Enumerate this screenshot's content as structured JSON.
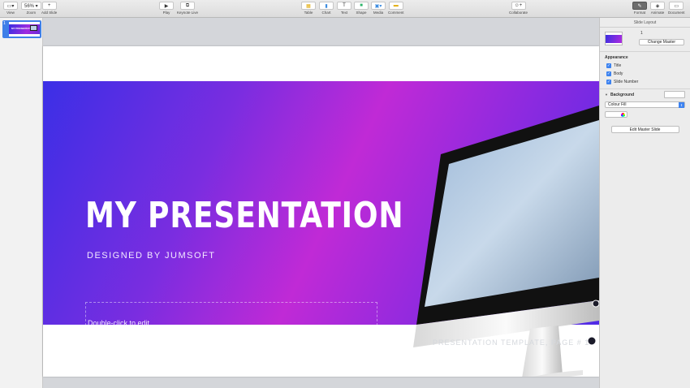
{
  "toolbar": {
    "left": [
      {
        "icon": "sidebar-view-icon",
        "label": "View",
        "glyph": "▭▾"
      },
      {
        "icon": "zoom-icon",
        "label": "Zoom",
        "glyph": "56% ▾"
      },
      {
        "icon": "plus-icon",
        "label": "Add Slide",
        "glyph": "+"
      }
    ],
    "center_left": [
      {
        "icon": "play-icon",
        "label": "Play",
        "glyph": "▶"
      },
      {
        "icon": "keynote-live-icon",
        "label": "Keynote Live",
        "glyph": "⧉"
      }
    ],
    "insert": [
      {
        "icon": "table-icon",
        "label": "Table",
        "glyph": "▦",
        "color": "#f5c518"
      },
      {
        "icon": "chart-icon",
        "label": "Chart",
        "glyph": "▮",
        "color": "#3d8de0"
      },
      {
        "icon": "text-icon",
        "label": "Text",
        "glyph": "T"
      },
      {
        "icon": "shape-icon",
        "label": "Shape",
        "glyph": "■",
        "color": "#2fb56b"
      },
      {
        "icon": "media-icon",
        "label": "Media",
        "glyph": "▣▾",
        "color": "#3d8de0"
      },
      {
        "icon": "comment-icon",
        "label": "Comment",
        "glyph": "▬",
        "color": "#f5c518"
      }
    ],
    "collaborate": {
      "icon": "collaborate-icon",
      "label": "Collaborate",
      "glyph": "☺+"
    },
    "right": [
      {
        "icon": "format-brush-icon",
        "label": "Format",
        "glyph": "✎",
        "active": true
      },
      {
        "icon": "animate-icon",
        "label": "Animate",
        "glyph": "◈"
      },
      {
        "icon": "document-icon",
        "label": "Document",
        "glyph": "▭"
      }
    ]
  },
  "navigator": {
    "slides": [
      {
        "number": "1",
        "thumb_title": "MY PRESENTATION"
      }
    ]
  },
  "slide": {
    "title": "MY PRESENTATION",
    "subtitle": "DESIGNED BY JUMSOFT",
    "body_placeholder": "Double-click to edit",
    "footer": "PRESENTATION TEMPLATE, PAGE #    1"
  },
  "inspector": {
    "header": "Slide Layout",
    "layout_number": "1",
    "change_master": "Change Master",
    "appearance_label": "Appearance",
    "checks": [
      {
        "label": "Title",
        "checked": true
      },
      {
        "label": "Body",
        "checked": true
      },
      {
        "label": "Slide Number",
        "checked": true
      }
    ],
    "background_label": "Background",
    "fill_select": "Colour Fill",
    "edit_master": "Edit Master Slide"
  },
  "colors": {
    "accent": "#3c82f0",
    "hero_start": "#3b2fe6",
    "hero_mid": "#c02ad6"
  }
}
